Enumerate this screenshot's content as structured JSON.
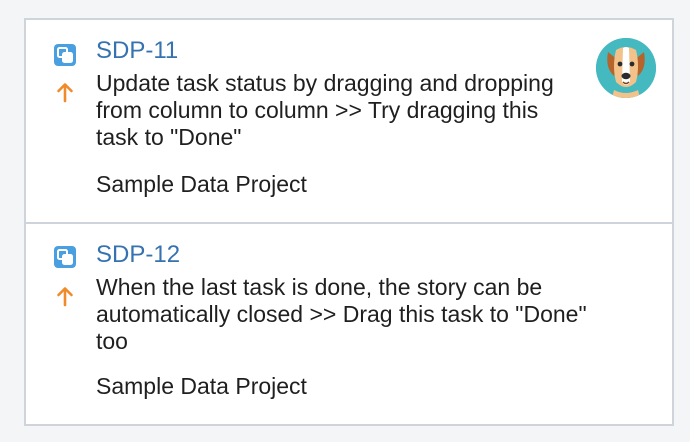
{
  "cards": [
    {
      "key": "SDP-11",
      "summary": "Update task status by dragging and dropping from column to column >> Try dragging this task to \"Done\"",
      "project": "Sample Data Project",
      "type_icon": "subtask-icon",
      "priority_icon": "priority-up-arrow-icon",
      "avatar_icon": "dog-avatar-icon"
    },
    {
      "key": "SDP-12",
      "summary": "When the last task is done, the story can be automatically closed >> Drag this task to \"Done\" too",
      "project": "Sample Data Project",
      "type_icon": "subtask-icon",
      "priority_icon": "priority-up-arrow-icon"
    }
  ],
  "colors": {
    "key_link": "#3572b0",
    "type_icon_bg": "#4a9fe0",
    "priority_arrow": "#f08b2b",
    "avatar_bg": "#45b9c0",
    "card_border": "#cfd4db",
    "column_bg": "#f4f5f7"
  }
}
